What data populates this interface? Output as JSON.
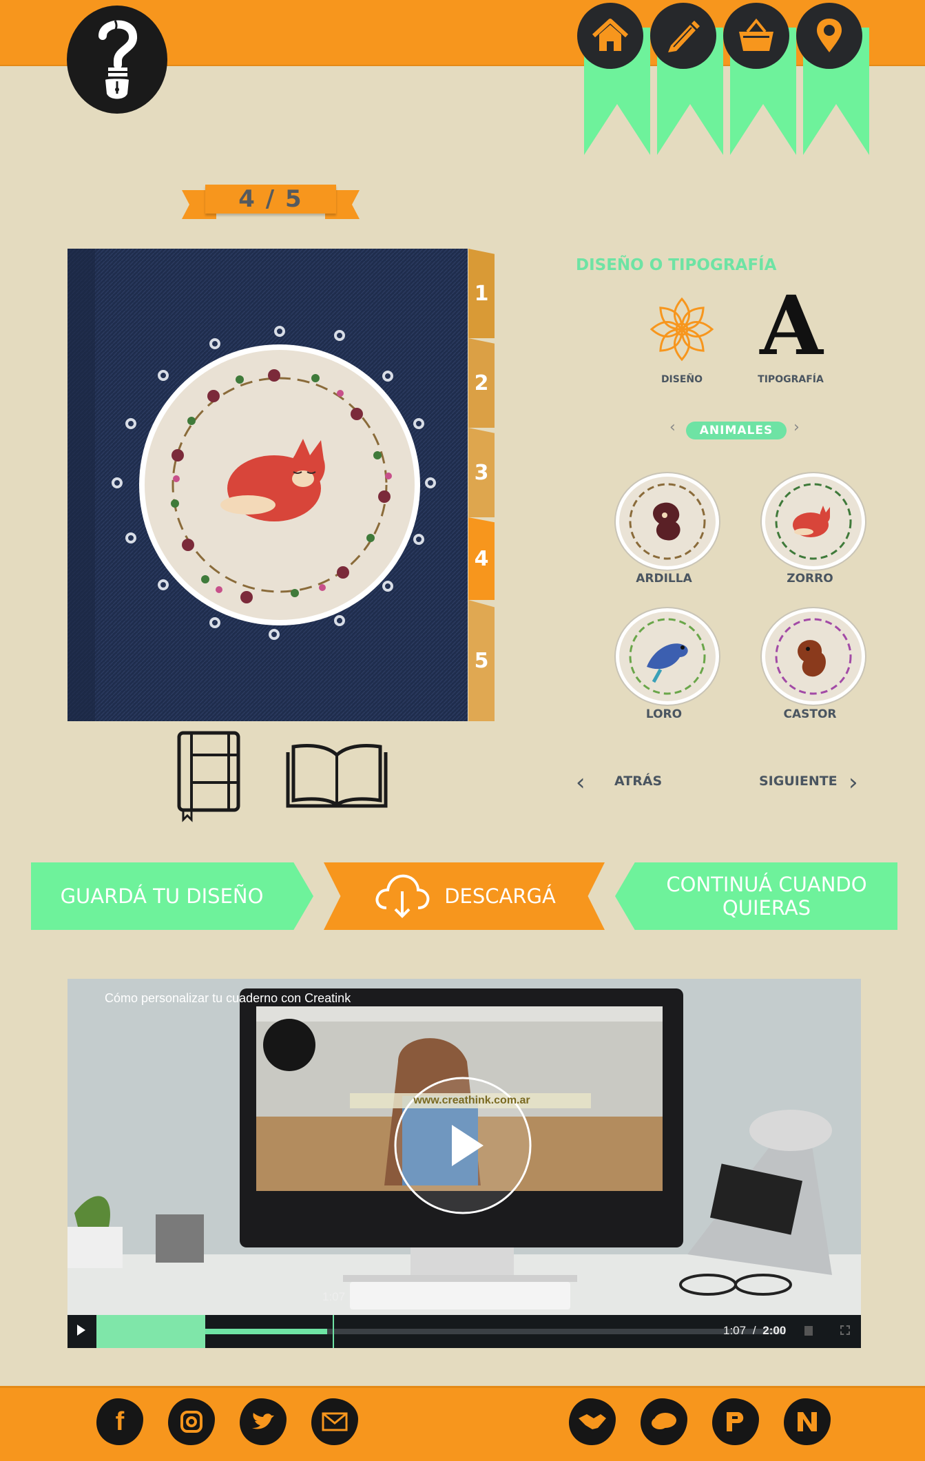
{
  "header": {
    "nav": [
      {
        "name": "home",
        "icon": "home-icon"
      },
      {
        "name": "design",
        "icon": "pencil-icon"
      },
      {
        "name": "cart",
        "icon": "basket-icon"
      },
      {
        "name": "location",
        "icon": "location-pin-icon"
      }
    ]
  },
  "step": {
    "counter": "4 / 5"
  },
  "preview": {
    "tabs": [
      "1",
      "2",
      "3",
      "4",
      "5"
    ],
    "active_tab": "4",
    "views": [
      {
        "name": "closed-notebook",
        "icon": "closed-notebook-icon"
      },
      {
        "name": "open-book",
        "icon": "open-book-icon"
      }
    ]
  },
  "panel": {
    "title": "DISEÑO O TIPOGRAFÍA",
    "options": [
      {
        "label": "DISEÑO",
        "icon": "flower-icon"
      },
      {
        "label": "TIPOGRAFÍA",
        "icon": "letter-a-icon",
        "glyph": "A"
      }
    ],
    "category": "ANIMALES",
    "category_prev": "‹",
    "category_next": "›",
    "designs": [
      {
        "label": "ARDILLA"
      },
      {
        "label": "ZORRO"
      },
      {
        "label": "LORO"
      },
      {
        "label": "CASTOR"
      }
    ],
    "back_label": "ATRÁS",
    "next_label": "SIGUIENTE",
    "back_arrow": "‹",
    "next_arrow": "›"
  },
  "actions": {
    "save": "GUARDÁ TU DISEÑO",
    "download": "DESCARGÁ",
    "continue": "CONTINUÁ CUANDO QUIERAS"
  },
  "video": {
    "title": "Cómo personalizar tu cuaderno con Creatink",
    "url_overlay": "www.creathink.com.ar",
    "hover_time": "1:07",
    "current_time": "1:07",
    "separator": "/",
    "duration": "2:00",
    "progress": 0.335
  },
  "footer": {
    "social_left": [
      "facebook-icon",
      "instagram-icon",
      "twitter-icon",
      "mail-icon"
    ],
    "social_right": [
      "handshake-icon",
      "chat-icon",
      "parking-icon",
      "news-icon"
    ]
  },
  "colors": {
    "orange": "#f7961d",
    "mint": "#6ef29b",
    "background": "#e4dbbf",
    "dark": "#26282b"
  }
}
